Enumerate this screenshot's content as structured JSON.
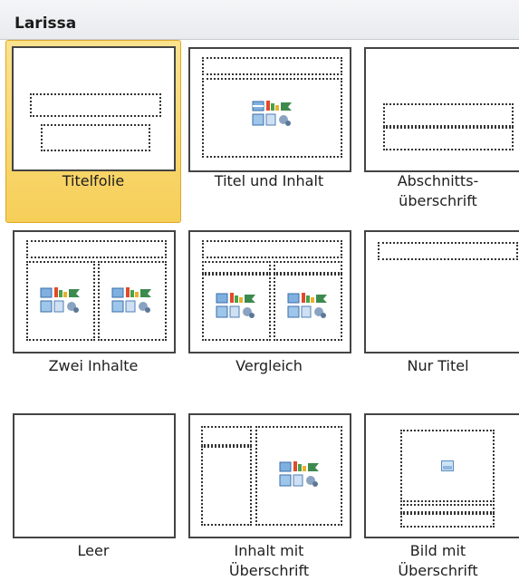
{
  "panel": {
    "title": "Larissa"
  },
  "layouts": [
    {
      "label": "Titelfolie",
      "selected": true
    },
    {
      "label": "Titel und Inhalt",
      "selected": false
    },
    {
      "label": "Abschnitts-\nüberschrift",
      "label_line1": "Abschnitts-",
      "label_line2": "überschrift",
      "selected": false
    },
    {
      "label": "Zwei Inhalte",
      "selected": false
    },
    {
      "label": "Vergleich",
      "selected": false
    },
    {
      "label": "Nur Titel",
      "selected": false
    },
    {
      "label": "Leer",
      "selected": false
    },
    {
      "label_line1": "Inhalt mit",
      "label_line2": "Überschrift",
      "selected": false
    },
    {
      "label_line1": "Bild mit",
      "label_line2": "Überschrift",
      "selected": false
    }
  ],
  "colors": {
    "selected_fill": "#f6cf58",
    "selected_border": "#e0a827",
    "header_bg": "#eceef1"
  }
}
